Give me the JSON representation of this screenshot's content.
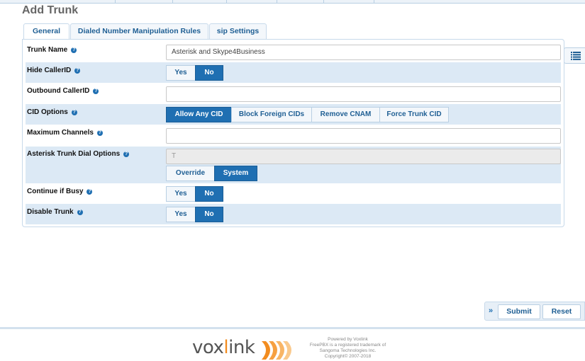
{
  "page": {
    "title": "Add Trunk"
  },
  "tabs": [
    {
      "label": "General",
      "active": true
    },
    {
      "label": "Dialed Number Manipulation Rules",
      "active": false
    },
    {
      "label": "sip Settings",
      "active": false
    }
  ],
  "fields": {
    "trunk_name": {
      "label": "Trunk Name",
      "value": "Asterisk and Skype4Business",
      "placeholder": ""
    },
    "hide_callerid": {
      "label": "Hide CallerID",
      "options": [
        "Yes",
        "No"
      ],
      "selected": "No"
    },
    "outbound_callerid": {
      "label": "Outbound CallerID",
      "value": ""
    },
    "cid_options": {
      "label": "CID Options",
      "options": [
        "Allow Any CID",
        "Block Foreign CIDs",
        "Remove CNAM",
        "Force Trunk CID"
      ],
      "selected": "Allow Any CID"
    },
    "max_channels": {
      "label": "Maximum Channels",
      "value": ""
    },
    "dial_options": {
      "label": "Asterisk Trunk Dial Options",
      "value": "T",
      "options": [
        "Override",
        "System"
      ],
      "selected": "System"
    },
    "continue_if_busy": {
      "label": "Continue if Busy",
      "options": [
        "Yes",
        "No"
      ],
      "selected": "No"
    },
    "disable_trunk": {
      "label": "Disable Trunk",
      "options": [
        "Yes",
        "No"
      ],
      "selected": "No"
    }
  },
  "actions": {
    "submit": "Submit",
    "reset": "Reset",
    "expand": "»"
  },
  "help_glyph": "?",
  "footer": {
    "logo_pre": "vox",
    "logo_i": "l",
    "logo_post": "ink",
    "powered": "Powered by Voxlink",
    "trademark": "FreePBX is a registered trademark of",
    "company": "Sangoma Technologies Inc.",
    "copyright": "Copyright© 2007-2018"
  },
  "colors": {
    "accent": "#1f6fb2",
    "row_shade": "#dce9f5",
    "logo_accent": "#f28c1f"
  }
}
